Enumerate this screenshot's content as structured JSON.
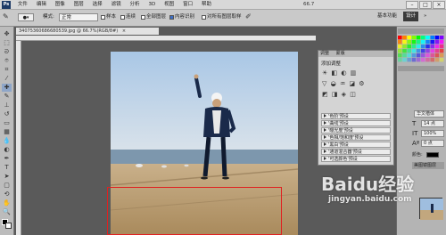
{
  "menubar": {
    "logo": "Ps",
    "items": [
      "文件",
      "编辑",
      "图像",
      "图层",
      "选择",
      "滤镜",
      "分析",
      "3D",
      "视图",
      "窗口",
      "帮助"
    ],
    "zoom": "66.7",
    "window_buttons": [
      "–",
      "□",
      "×"
    ]
  },
  "workspaces": {
    "basic": "基本功能",
    "design": "设计",
    "more": "»"
  },
  "options": {
    "mode_label": "模式:",
    "mode_value": "正常",
    "opacity_label": "不透明度:",
    "opacity_value": "100%",
    "flow_label": "流量:",
    "flow_value": "100%",
    "checks": [
      "样本",
      "连续",
      "全部图层",
      "内容识别",
      "对所有图层取样"
    ]
  },
  "document": {
    "tab_title": "34075360686680539.jpg @ 66.7%(RGB/8#)",
    "close": "×"
  },
  "adjust_panel": {
    "tabs": [
      "调整",
      "蒙版"
    ],
    "title": "添加调整",
    "presets": [
      "'色阶'预设",
      "'曲线'预设",
      "'曝光度'预设",
      "'色相/饱和度'预设",
      "'黑白'预设",
      "'通道混合器'预设",
      "'可选颜色'预设"
    ]
  },
  "char_panel": {
    "font": "华文楷体",
    "size": "14 点",
    "tracking": "100%",
    "scale": "0 点",
    "color_label": "颜色:"
  },
  "layers_panel": {
    "title": "美图镜图层"
  },
  "watermark": {
    "brand": "Baidu经验",
    "url": "jingyan.baidu.com"
  },
  "colors": {
    "selection": "#e02020",
    "accent": "#1d3a66"
  }
}
